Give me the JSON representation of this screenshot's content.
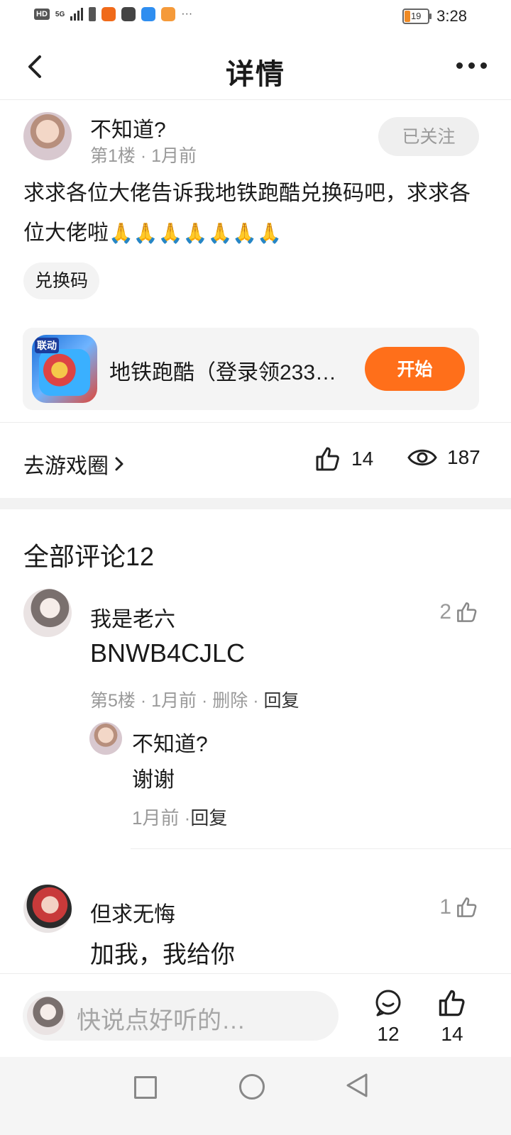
{
  "status_bar": {
    "hd": "HD",
    "network": "5G",
    "battery": "19",
    "time": "3:28"
  },
  "header": {
    "title": "详情"
  },
  "post": {
    "author": "不知道?",
    "meta": "第1楼 · 1月前",
    "follow_label": "已关注",
    "body": "求求各位大佬告诉我地铁跑酷兑换码吧，求求各位大佬啦",
    "pray": "🙏🙏🙏🙏🙏🙏🙏",
    "tag": "兑换码",
    "game": {
      "badge": "联动",
      "title": "地铁跑酷（登录领233…",
      "start_label": "开始"
    },
    "to_circle": "去游戏圈",
    "likes": "14",
    "views": "187"
  },
  "comments_title": "全部评论12",
  "comments": [
    {
      "name": "我是老六",
      "likes": "2",
      "text": "BNWB4CJLC",
      "meta_prefix": "第5楼 · 1月前 · 删除 · ",
      "reply_label": "回复",
      "reply": {
        "name": "不知道?",
        "text": "谢谢",
        "meta_prefix": "1月前 ·",
        "reply_label": "回复"
      }
    },
    {
      "name": "但求无悔",
      "likes": "1",
      "text": "加我，我给你"
    }
  ],
  "bottom_bar": {
    "placeholder": "快说点好听的…",
    "comment_count": "12",
    "like_count": "14"
  }
}
